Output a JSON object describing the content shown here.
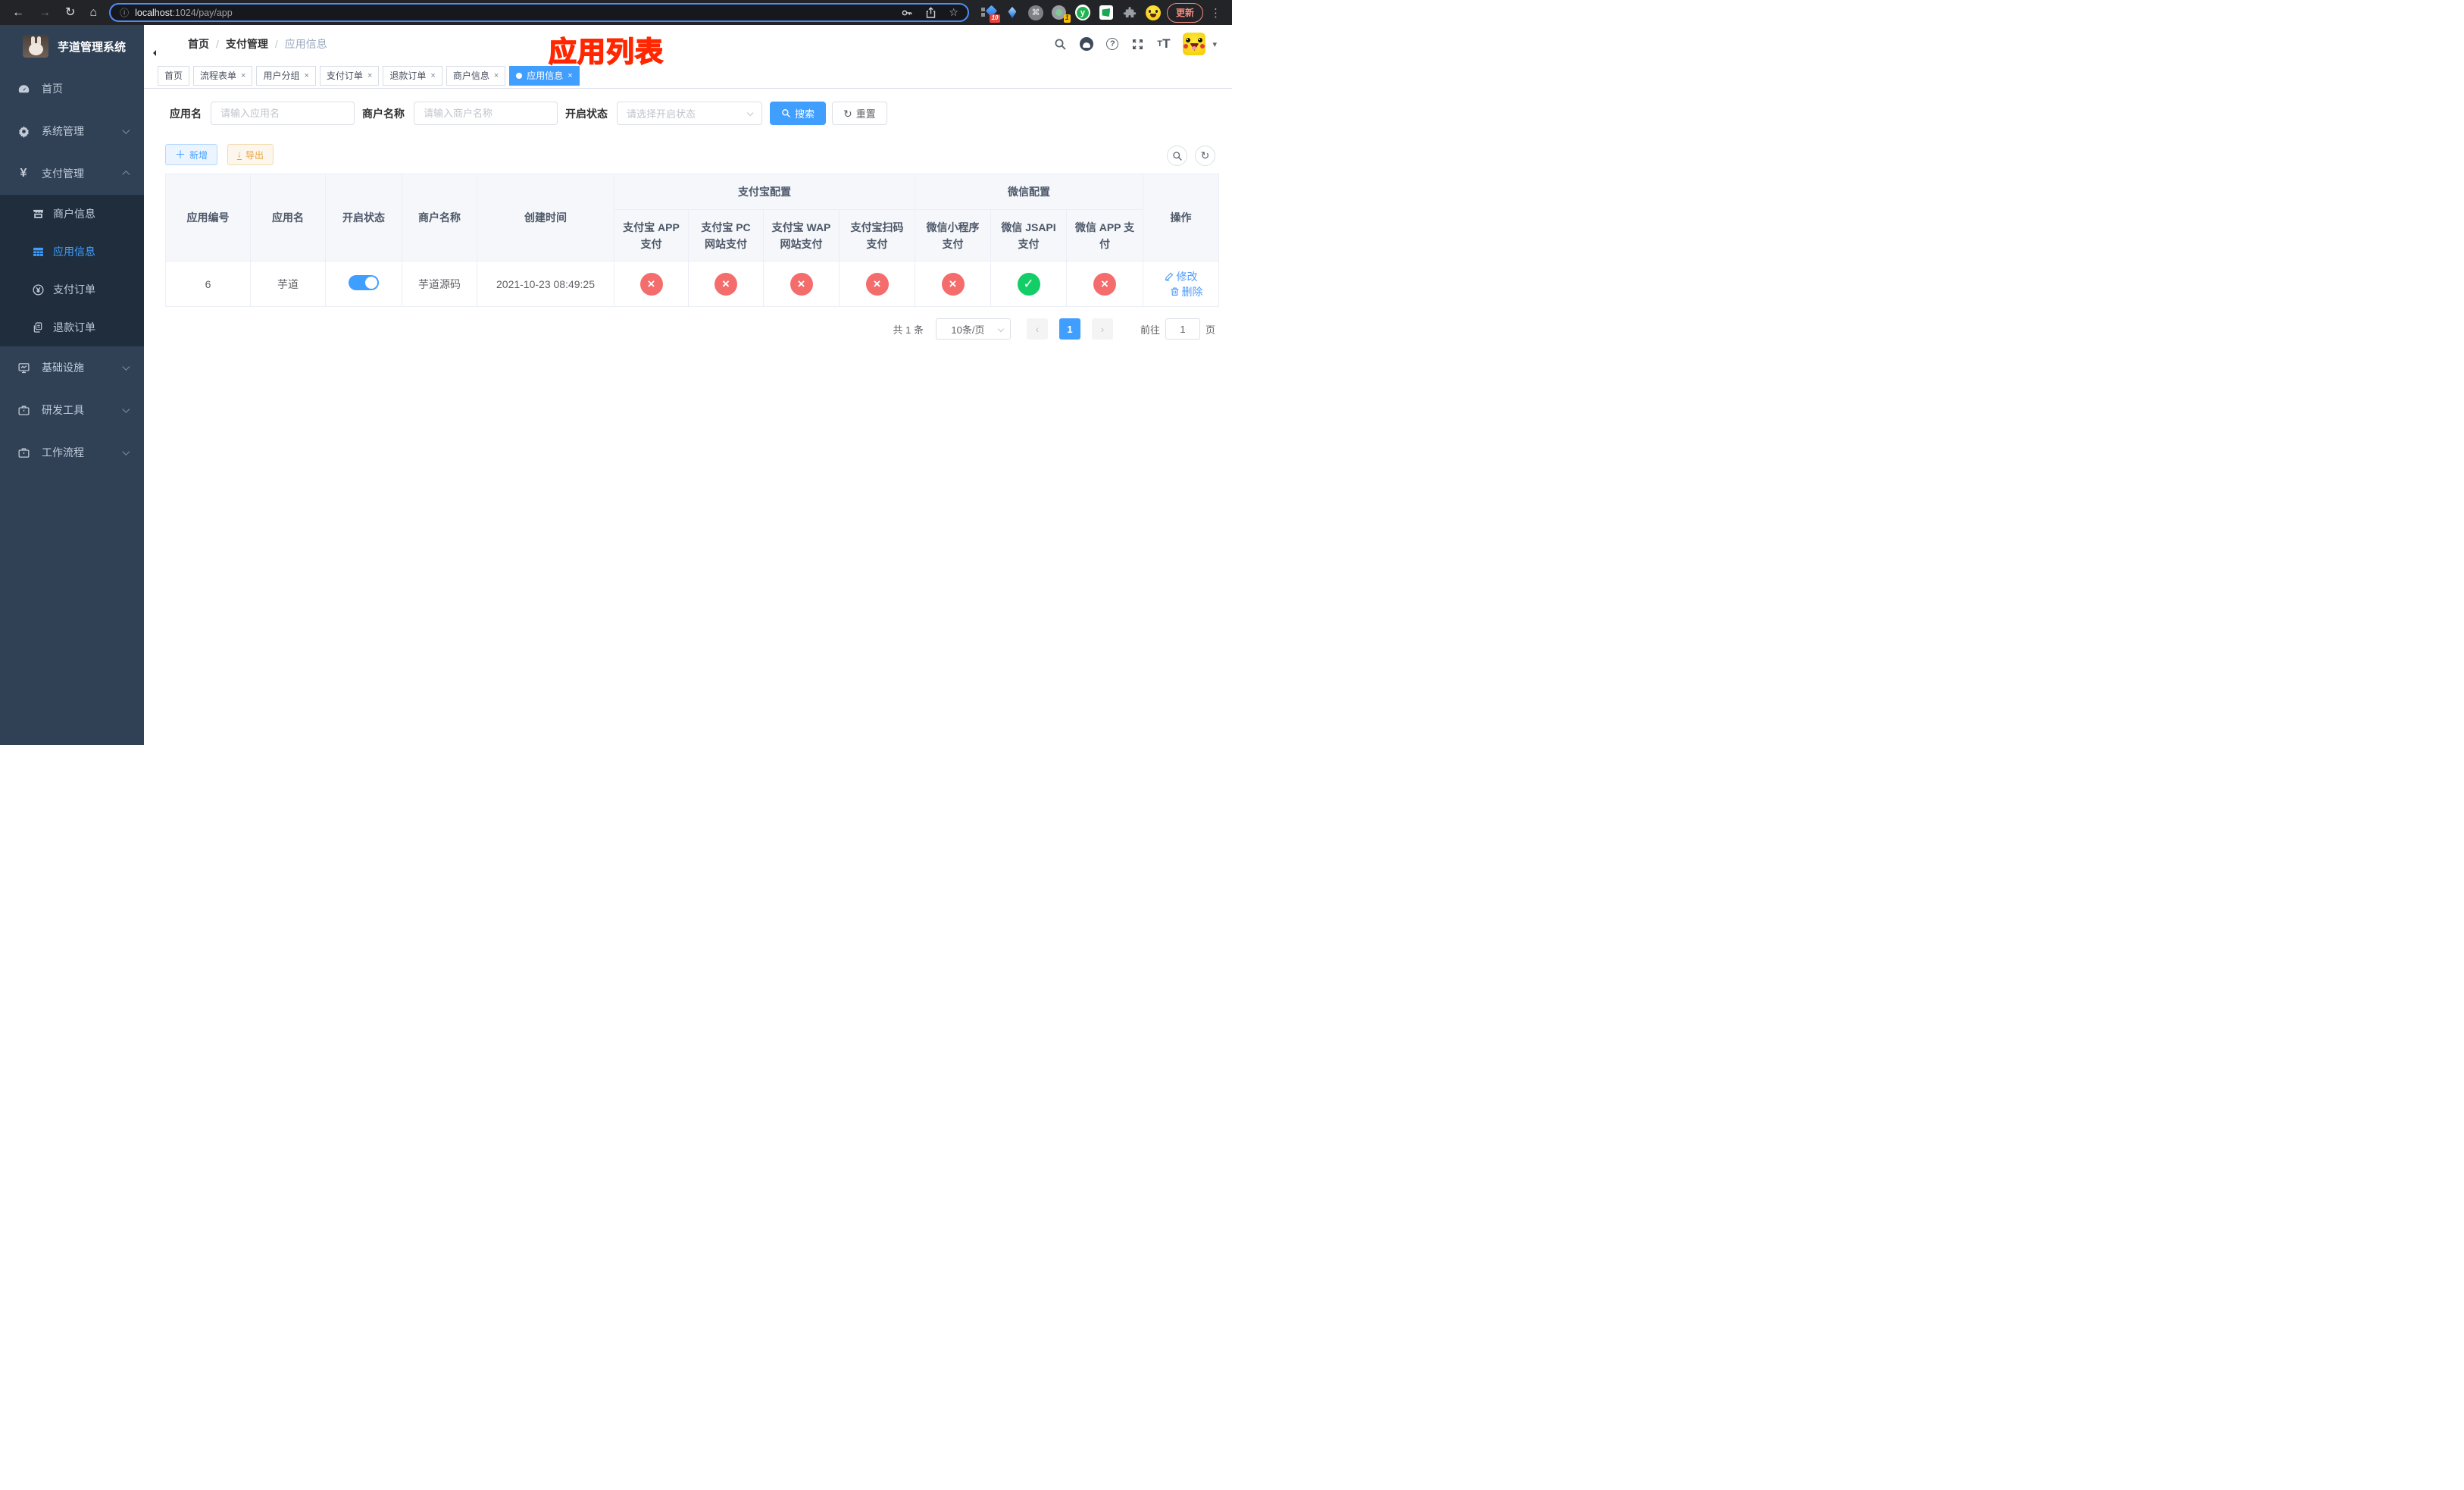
{
  "colors": {
    "primary": "#409eff",
    "success": "#13ce66",
    "danger": "#f56c6c",
    "warning": "#e6a23c",
    "annotation_red": "#ff2600",
    "sidebar_bg": "#304156",
    "submenu_bg": "#1f2d3d"
  },
  "icons": {
    "back": "←",
    "forward": "→",
    "reload": "↻",
    "home": "⌂",
    "info": "ⓘ",
    "star": "☆",
    "command": "⌘",
    "kebab": "⋮",
    "plus": "＋",
    "download": "↓",
    "close": "×",
    "check": "✓",
    "cross": "×",
    "prev": "‹",
    "next": "›",
    "caret_down": "▾",
    "refresh": "↻"
  },
  "browser": {
    "url_host": "localhost",
    "url_rest": ":1024/pay/app",
    "ext_badge_1": "10",
    "ext_badge_2": "1",
    "ext_y_label": "y",
    "update_button": "更新"
  },
  "sidebar": {
    "title": "芋道管理系统",
    "menu_top": [
      {
        "label": "首页",
        "icon": "dashboard-icon"
      },
      {
        "label": "系统管理",
        "icon": "gear-icon"
      },
      {
        "label": "支付管理",
        "icon": "yen-icon"
      }
    ],
    "yen_glyph": "¥",
    "submenu": [
      {
        "label": "商户信息",
        "icon": "storefront-icon"
      },
      {
        "label": "应用信息",
        "icon": "grid-icon",
        "active": true
      },
      {
        "label": "支付订单",
        "icon": "yen-circle-icon"
      },
      {
        "label": "退款订单",
        "icon": "documents-icon"
      }
    ],
    "menu_bottom": [
      {
        "label": "基础设施",
        "icon": "monitor-icon"
      },
      {
        "label": "研发工具",
        "icon": "briefcase-icon"
      },
      {
        "label": "工作流程",
        "icon": "briefcase-icon"
      }
    ]
  },
  "header": {
    "breadcrumb": [
      "首页",
      "支付管理",
      "应用信息"
    ],
    "separator": "/",
    "annotation": "应用列表",
    "font_icon_small": "T",
    "font_icon_big": "T",
    "question_mark": "?"
  },
  "tabs": [
    {
      "label": "首页",
      "closable": false,
      "active": false
    },
    {
      "label": "流程表单",
      "closable": true,
      "active": false
    },
    {
      "label": "用户分组",
      "closable": true,
      "active": false
    },
    {
      "label": "支付订单",
      "closable": true,
      "active": false
    },
    {
      "label": "退款订单",
      "closable": true,
      "active": false
    },
    {
      "label": "商户信息",
      "closable": true,
      "active": false
    },
    {
      "label": "应用信息",
      "closable": true,
      "active": true
    }
  ],
  "filters": {
    "app_name_label": "应用名",
    "app_name_placeholder": "请输入应用名",
    "merchant_label": "商户名称",
    "merchant_placeholder": "请输入商户名称",
    "status_label": "开启状态",
    "status_placeholder": "请选择开启状态",
    "search_button": "搜索",
    "reset_button": "重置"
  },
  "toolbar": {
    "add_button": "新增",
    "export_button": "导出"
  },
  "table": {
    "columns": {
      "app_id": "应用编号",
      "app_name": "应用名",
      "status": "开启状态",
      "merchant_name": "商户名称",
      "created_at": "创建时间",
      "alipay_group": "支付宝配置",
      "wechat_group": "微信配置",
      "alipay_app": "支付宝 APP 支付",
      "alipay_pc": "支付宝 PC 网站支付",
      "alipay_wap": "支付宝 WAP 网站支付",
      "alipay_qr": "支付宝扫码支付",
      "wx_lite": "微信小程序支付",
      "wx_jsapi": "微信 JSAPI 支付",
      "wx_app": "微信 APP 支付",
      "actions": "操作"
    },
    "rows": [
      {
        "app_id": "6",
        "app_name": "芋道",
        "enabled": true,
        "merchant_name": "芋道源码",
        "created_at": "2021-10-23 08:49:25",
        "statuses": {
          "alipay_app": false,
          "alipay_pc": false,
          "alipay_wap": false,
          "alipay_qr": false,
          "wx_lite": false,
          "wx_jsapi": true,
          "wx_app": false
        },
        "action_edit": "修改",
        "action_delete": "删除"
      }
    ]
  },
  "pagination": {
    "total": "共 1 条",
    "page_size": "10条/页",
    "current_page": "1",
    "goto_prefix": "前往",
    "goto_value": "1",
    "goto_suffix": "页"
  }
}
